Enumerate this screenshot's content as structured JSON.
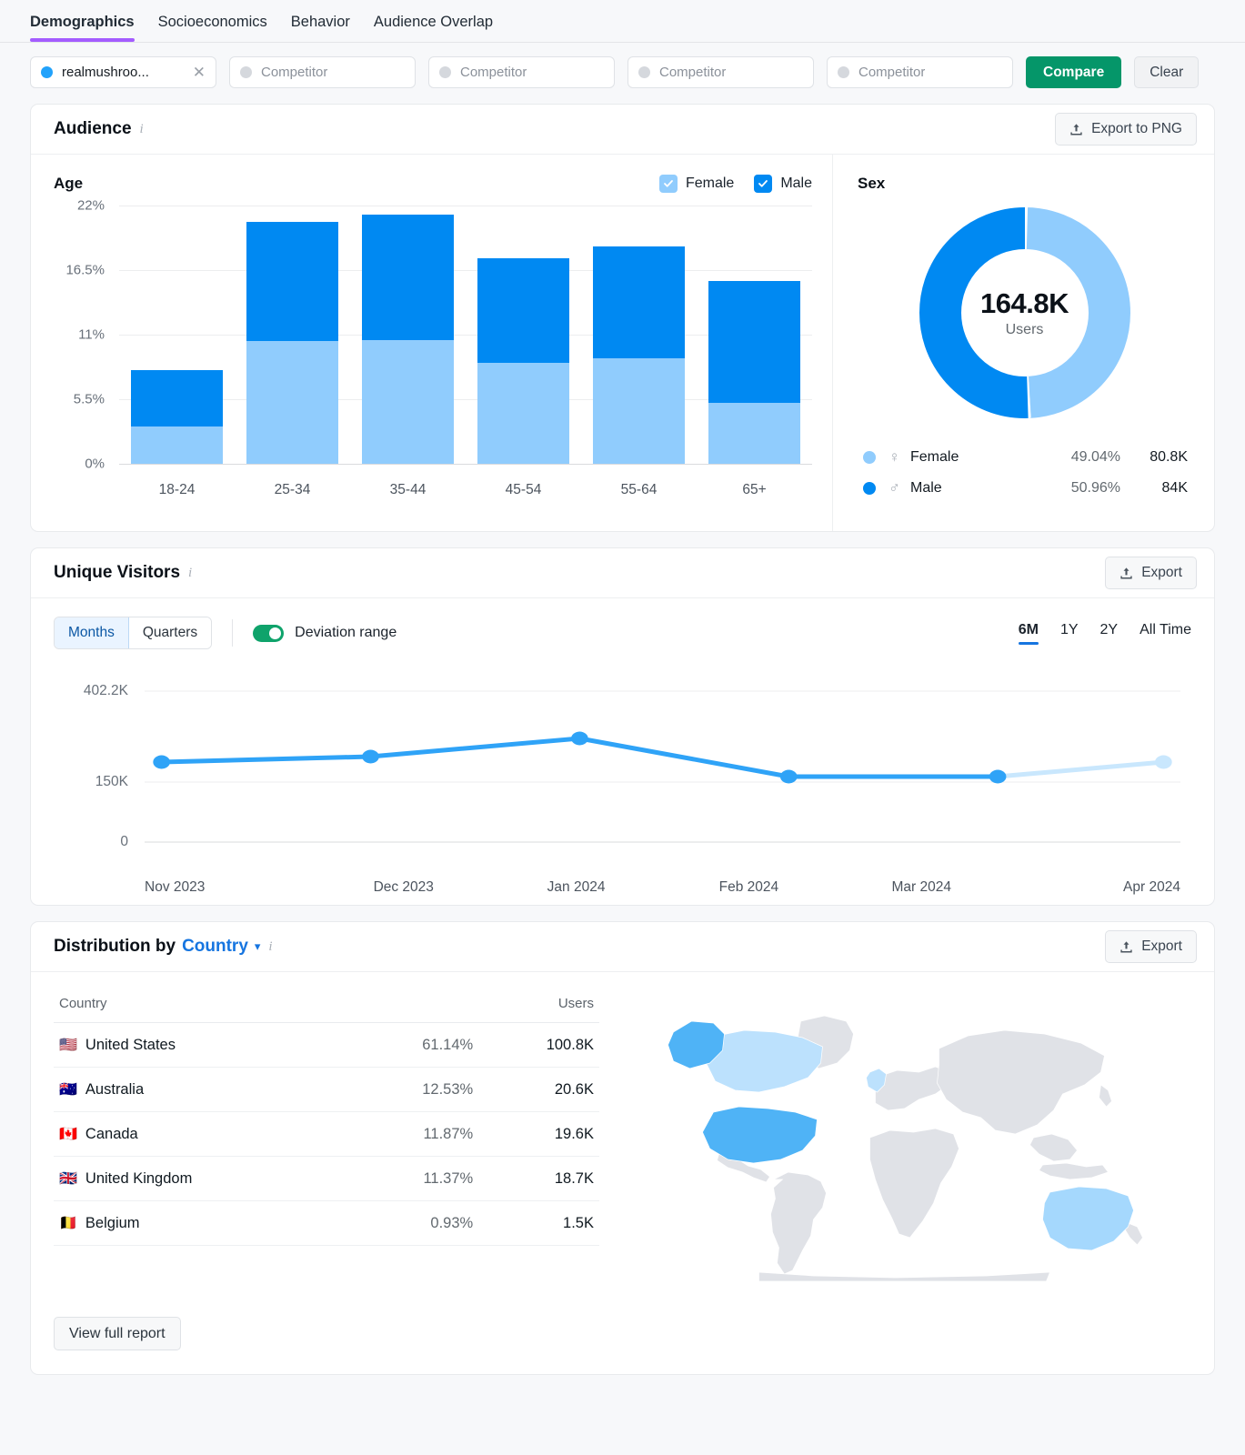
{
  "tabs": [
    {
      "label": "Demographics",
      "active": true
    },
    {
      "label": "Socioeconomics",
      "active": false
    },
    {
      "label": "Behavior",
      "active": false
    },
    {
      "label": "Audience Overlap",
      "active": false
    }
  ],
  "chips": [
    {
      "label": "realmushroo...",
      "filled": true,
      "close": "✕"
    },
    {
      "label": "Competitor",
      "filled": false
    },
    {
      "label": "Competitor",
      "filled": false
    },
    {
      "label": "Competitor",
      "filled": false
    },
    {
      "label": "Competitor",
      "filled": false
    }
  ],
  "actions": {
    "compare": "Compare",
    "clear": "Clear"
  },
  "audience": {
    "title": "Audience",
    "export_label": "Export to PNG",
    "age_label": "Age",
    "sex_label": "Sex",
    "legend": [
      {
        "label": "Female",
        "color": "#90ccfd"
      },
      {
        "label": "Male",
        "color": "#0089f2"
      }
    ],
    "donut": {
      "value": "164.8K",
      "sub": "Users"
    },
    "sex_rows": [
      {
        "symbol": "♀",
        "name": "Female",
        "pct": "49.04%",
        "value": "80.8K",
        "color": "#90ccfd"
      },
      {
        "symbol": "♂",
        "name": "Male",
        "pct": "50.96%",
        "value": "84K",
        "color": "#0089f2"
      }
    ]
  },
  "unique_visitors": {
    "title": "Unique Visitors",
    "export_label": "Export",
    "granularity": [
      {
        "label": "Months",
        "active": true
      },
      {
        "label": "Quarters",
        "active": false
      }
    ],
    "deviation_label": "Deviation range",
    "deviation_on": true,
    "ranges": [
      {
        "label": "6M",
        "active": true
      },
      {
        "label": "1Y",
        "active": false
      },
      {
        "label": "2Y",
        "active": false
      },
      {
        "label": "All Time",
        "active": false
      }
    ]
  },
  "distribution": {
    "title_prefix": "Distribution by",
    "title_link": "Country",
    "export_label": "Export",
    "columns": [
      "Country",
      "",
      "Users"
    ],
    "rows": [
      {
        "flag": "🇺🇸",
        "country": "United States",
        "pct": "61.14%",
        "users": "100.8K"
      },
      {
        "flag": "🇦🇺",
        "country": "Australia",
        "pct": "12.53%",
        "users": "20.6K"
      },
      {
        "flag": "🇨🇦",
        "country": "Canada",
        "pct": "11.87%",
        "users": "19.6K"
      },
      {
        "flag": "🇬🇧",
        "country": "United Kingdom",
        "pct": "11.37%",
        "users": "18.7K"
      },
      {
        "flag": "🇧🇪",
        "country": "Belgium",
        "pct": "0.93%",
        "users": "1.5K"
      }
    ],
    "view_full_report": "View full report"
  },
  "chart_data": [
    {
      "type": "bar",
      "title": "Age",
      "stacked": true,
      "categories": [
        "18-24",
        "25-34",
        "35-44",
        "45-54",
        "55-64",
        "65+"
      ],
      "series": [
        {
          "name": "Female",
          "color": "#90ccfd",
          "values": [
            3.2,
            10.5,
            10.5,
            8.6,
            9.0,
            5.2
          ]
        },
        {
          "name": "Male",
          "color": "#0089f2",
          "values": [
            4.8,
            10.1,
            10.7,
            8.9,
            9.5,
            10.4
          ]
        }
      ],
      "totals": [
        8.0,
        20.6,
        21.2,
        17.5,
        18.5,
        15.6
      ],
      "ylabel": "",
      "xlabel": "",
      "yticks": [
        "0%",
        "5.5%",
        "11%",
        "16.5%",
        "22%"
      ],
      "ylim": [
        0,
        22
      ],
      "grid": true,
      "legend_position": "top-right"
    },
    {
      "type": "pie",
      "title": "Sex",
      "donut": true,
      "center_value": "164.8K",
      "center_label": "Users",
      "labels": [
        "Female",
        "Male"
      ],
      "values": [
        49.04,
        50.96
      ],
      "absolute": [
        "80.8K",
        "84K"
      ],
      "colors": [
        "#90ccfd",
        "#0089f2"
      ]
    },
    {
      "type": "line",
      "title": "Unique Visitors",
      "x": [
        "Nov 2023",
        "Dec 2023",
        "Jan 2024",
        "Feb 2024",
        "Mar 2024",
        "Apr 2024"
      ],
      "values": [
        190000,
        205000,
        260000,
        160000,
        160000,
        190000
      ],
      "forecast_from_index": 4,
      "yticks": [
        "0",
        "150K",
        "402.2K"
      ],
      "ylim": [
        0,
        402200
      ],
      "grid": true,
      "color": "#2fa3f7",
      "forecast_color": "#c9e7fd"
    },
    {
      "type": "heatmap",
      "title": "Distribution by Country",
      "map": "world-choropleth",
      "regions": [
        {
          "name": "United States",
          "value": 61.14,
          "color": "#4fb3f6"
        },
        {
          "name": "Australia",
          "value": 12.53,
          "color": "#a5d8fd"
        },
        {
          "name": "Canada",
          "value": 11.87,
          "color": "#bce1fd"
        },
        {
          "name": "United Kingdom",
          "value": 11.37,
          "color": "#bce1fd"
        },
        {
          "name": "Belgium",
          "value": 0.93,
          "color": "#dfe1e6"
        }
      ],
      "base_color": "#e0e2e7"
    }
  ]
}
